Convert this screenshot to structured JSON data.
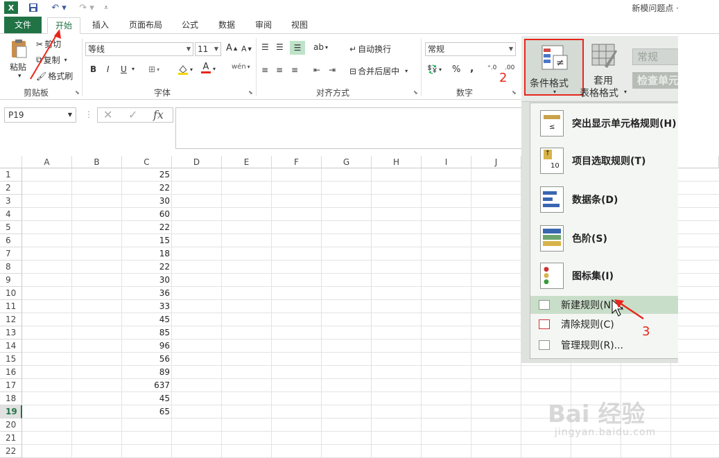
{
  "title": {
    "doc": "新模问题点 ·"
  },
  "tabs": [
    "文件",
    "开始",
    "插入",
    "页面布局",
    "公式",
    "数据",
    "审阅",
    "视图"
  ],
  "ribbon": {
    "clipboard": {
      "paste": "粘贴",
      "cut": "剪切",
      "copy": "复制",
      "painter": "格式刷",
      "group": "剪贴板"
    },
    "font": {
      "name": "等线",
      "size": "11",
      "bold": "B",
      "italic": "I",
      "underline": "U",
      "grow": "A",
      "shrink": "A",
      "group": "字体"
    },
    "align": {
      "wrap": "自动换行",
      "merge": "合并后居中",
      "group": "对齐方式"
    },
    "number": {
      "format": "常规",
      "percent": "%",
      "comma": ",",
      "group": "数字"
    }
  },
  "formula": {
    "namebox": "P19",
    "fx": "fx",
    "value": ""
  },
  "grid": {
    "columns": [
      "A",
      "B",
      "C",
      "D",
      "E",
      "F",
      "G",
      "H",
      "I",
      "J"
    ],
    "rows": [
      "1",
      "2",
      "3",
      "4",
      "5",
      "6",
      "7",
      "8",
      "9",
      "10",
      "11",
      "12",
      "13",
      "14",
      "15",
      "16",
      "17",
      "18",
      "19",
      "20",
      "21",
      "22"
    ],
    "selected_row": "19",
    "colC": [
      "25",
      "22",
      "30",
      "60",
      "22",
      "15",
      "18",
      "22",
      "30",
      "36",
      "33",
      "45",
      "85",
      "96",
      "56",
      "89",
      "637",
      "45",
      "65"
    ]
  },
  "overlay": {
    "cf_button": "条件格式",
    "table_format_1": "套用",
    "table_format_2": "表格格式",
    "style_normal": "常规",
    "style_check": "检查单元格",
    "menu": [
      {
        "label": "突出显示单元格规则(H)"
      },
      {
        "label": "项目选取规则(T)"
      },
      {
        "label": "数据条(D)"
      },
      {
        "label": "色阶(S)"
      },
      {
        "label": "图标集(I)"
      },
      {
        "label": "新建规则(N)..."
      },
      {
        "label": "清除规则(C)"
      },
      {
        "label": "管理规则(R)..."
      }
    ]
  },
  "annotations": {
    "step2": "2",
    "step3": "3"
  },
  "watermark": {
    "brand": "Bai 经验",
    "url": "jingyan.baidu.com"
  },
  "colors": {
    "excel_green": "#217346",
    "annotation_red": "#e8261b"
  }
}
